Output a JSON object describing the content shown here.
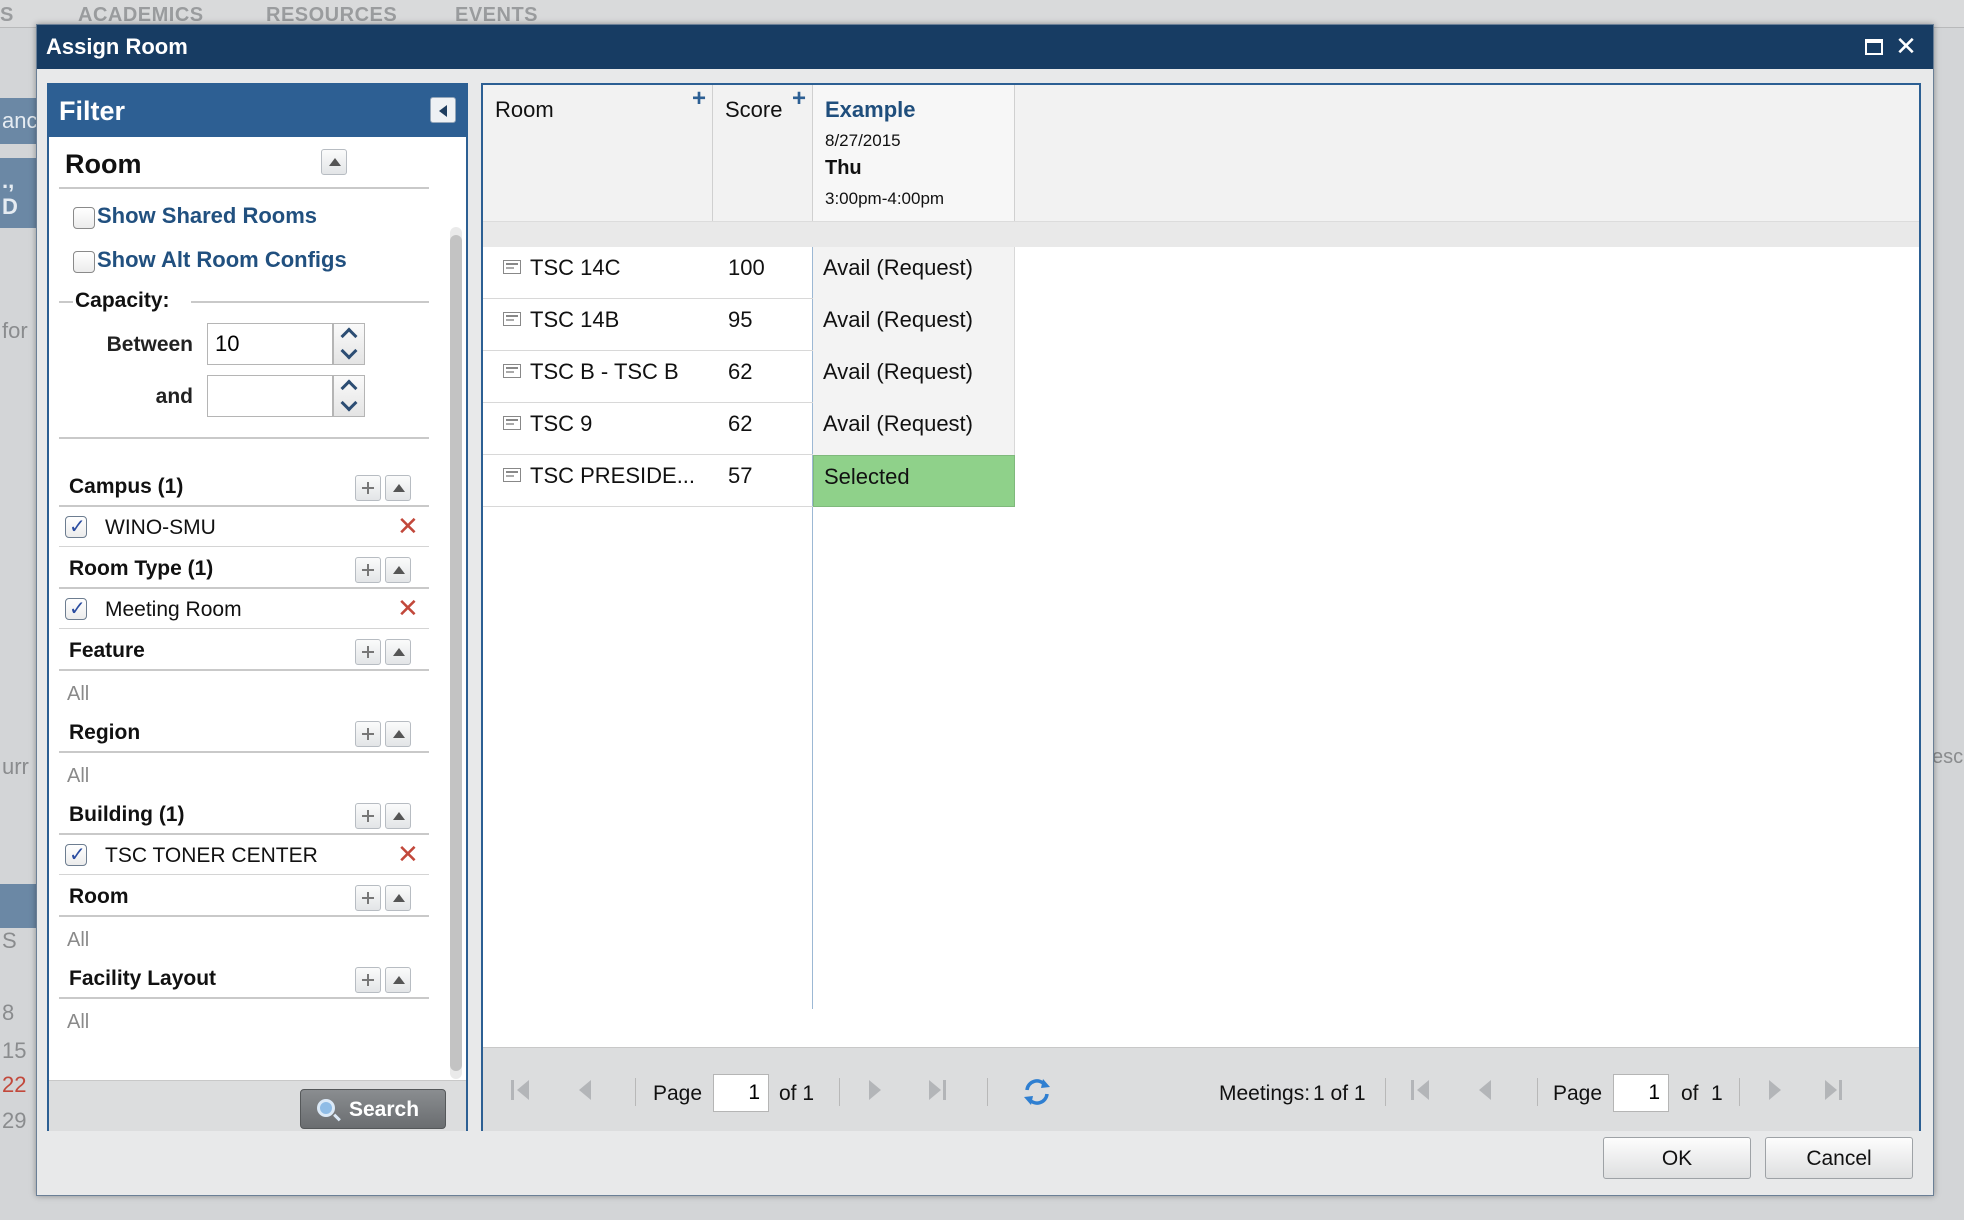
{
  "background": {
    "nav": [
      "S",
      "ACADEMICS",
      "RESOURCES",
      "EVENTS"
    ],
    "left_fragments": [
      "anc",
      "., D",
      "for",
      "urr",
      "S",
      "8",
      "15",
      "22",
      "29"
    ],
    "right_fragments": [
      "esc"
    ]
  },
  "dialog": {
    "title": "Assign Room"
  },
  "filter": {
    "title": "Filter",
    "room_section": "Room",
    "show_shared_rooms": "Show Shared Rooms",
    "show_alt_room_configs": "Show Alt Room Configs",
    "capacity_label": "Capacity:",
    "between_label": "Between",
    "between_value": "10",
    "and_label": "and",
    "and_value": "",
    "sections": [
      {
        "title": "Campus (1)",
        "items": [
          "WINO-SMU"
        ]
      },
      {
        "title": "Room Type (1)",
        "items": [
          "Meeting Room"
        ]
      },
      {
        "title": "Feature",
        "all": "All"
      },
      {
        "title": "Region",
        "all": "All"
      },
      {
        "title": "Building (1)",
        "items": [
          "TSC TONER CENTER"
        ]
      },
      {
        "title": "Room",
        "all": "All"
      },
      {
        "title": "Facility Layout",
        "all": "All"
      }
    ],
    "search_label": "Search"
  },
  "grid": {
    "columns": {
      "room": "Room",
      "score": "Score",
      "example_title": "Example",
      "example_date": "8/27/2015",
      "example_day": "Thu",
      "example_time": "3:00pm-4:00pm"
    },
    "rows": [
      {
        "room": "TSC 14C",
        "score": "100",
        "status": "Avail (Request)"
      },
      {
        "room": "TSC 14B",
        "score": "95",
        "status": "Avail (Request)"
      },
      {
        "room": "TSC B - TSC B",
        "score": "62",
        "status": "Avail (Request)"
      },
      {
        "room": "TSC 9",
        "score": "62",
        "status": "Avail (Request)"
      },
      {
        "room": "TSC PRESIDE...",
        "score": "57",
        "status": "Selected"
      }
    ],
    "pager": {
      "page_label": "Page",
      "page_value": "1",
      "of_label": "of 1",
      "meetings_label": "Meetings:",
      "meetings_value": "1 of 1",
      "page2_label": "Page",
      "page2_value": "1",
      "of2_label": "of",
      "of2_value": "1"
    }
  },
  "buttons": {
    "ok": "OK",
    "cancel": "Cancel"
  },
  "colors": {
    "title_bar": "#173c63",
    "filter_header": "#2d5f93",
    "selected_cell": "#8fd18a",
    "link_text": "#21507f"
  }
}
